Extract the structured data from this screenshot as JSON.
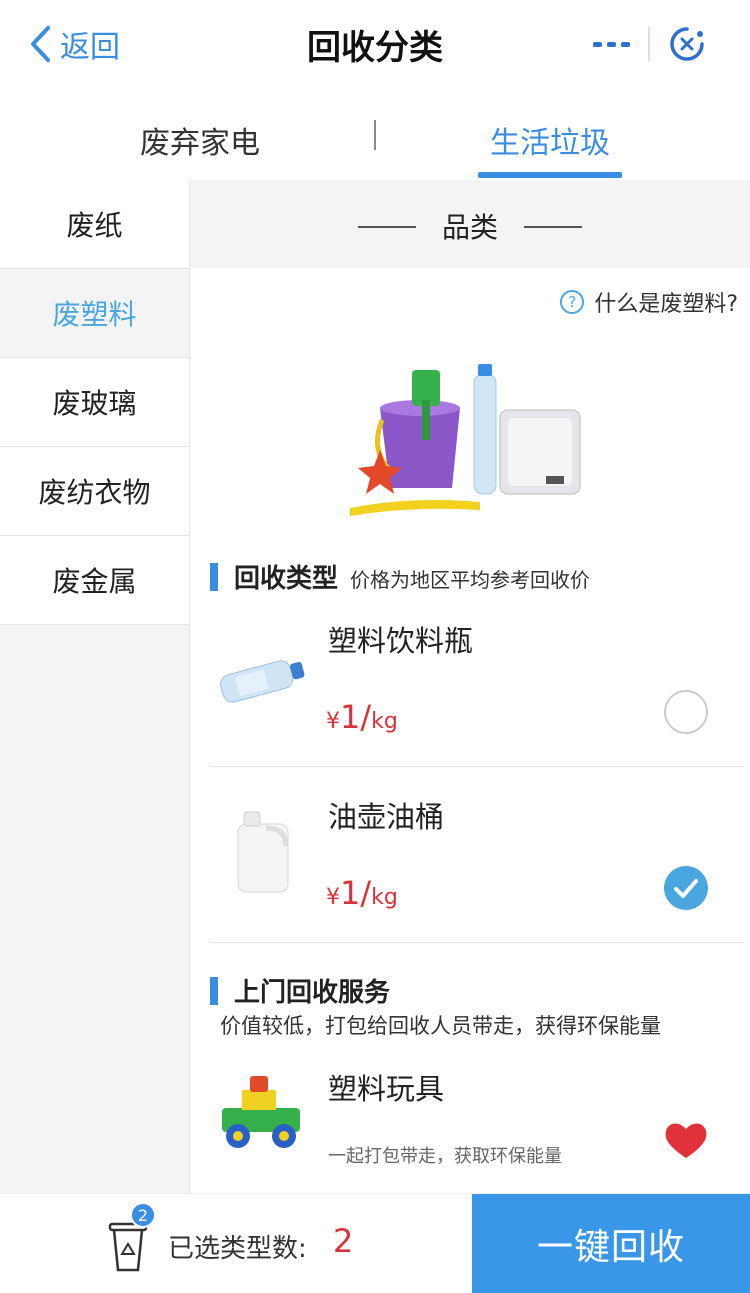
{
  "header": {
    "back_label": "返回",
    "title": "回收分类"
  },
  "tabs": [
    {
      "label": "废弃家电"
    },
    {
      "label": "生活垃圾"
    }
  ],
  "sidebar": {
    "items": [
      {
        "label": "废纸"
      },
      {
        "label": "废塑料"
      },
      {
        "label": "废玻璃"
      },
      {
        "label": "废纺衣物"
      },
      {
        "label": "废金属"
      }
    ]
  },
  "main": {
    "category_title": "品类",
    "help_text": "什么是废塑料?",
    "recycle_section": {
      "title": "回收类型",
      "subtitle": "价格为地区平均参考回收价"
    },
    "items": [
      {
        "name": "塑料饮料瓶",
        "price_yen": "¥",
        "price_num": "1/",
        "price_unit": "kg"
      },
      {
        "name": "油壶油桶",
        "price_yen": "¥",
        "price_num": "1/",
        "price_unit": "kg"
      }
    ],
    "service_section": {
      "title": "上门回收服务",
      "desc": "价值较低，打包给回收人员带走，获得环保能量"
    },
    "service_items": [
      {
        "name": "塑料玩具",
        "note": "一起打包带走，获取环保能量"
      }
    ]
  },
  "footer": {
    "badge": "2",
    "count_label": "已选类型数:",
    "count_value": "2",
    "button_label": "一键回收"
  },
  "colors": {
    "accent": "#3a8de0",
    "price": "#d8323a",
    "heart": "#e0323a"
  }
}
